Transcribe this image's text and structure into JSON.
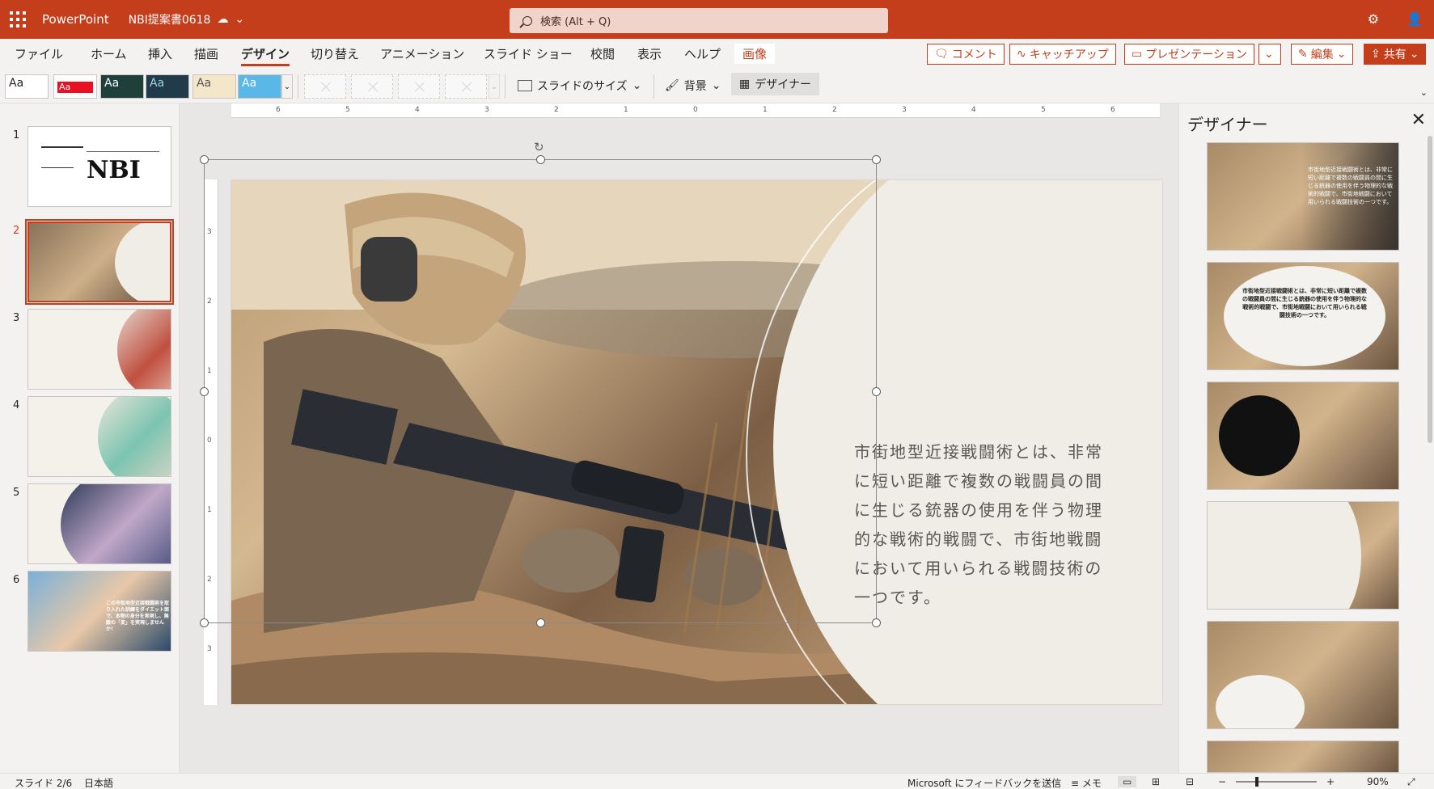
{
  "titlebar": {
    "app_name": "PowerPoint",
    "doc_name": "NBI提案書0618",
    "search_placeholder": "検索 (Alt + Q)"
  },
  "menu": {
    "tabs": [
      "ファイル",
      "ホーム",
      "挿入",
      "描画",
      "デザイン",
      "切り替え",
      "アニメーション",
      "スライド ショー",
      "校閲",
      "表示",
      "ヘルプ",
      "画像"
    ],
    "active_tab": "デザイン",
    "comment_label": "コメント",
    "catchup_label": "キャッチアップ",
    "present_label": "プレゼンテーション",
    "edit_label": "編集",
    "share_label": "共有"
  },
  "ribbon": {
    "theme_label": "Aa",
    "slide_size_label": "スライドのサイズ",
    "background_label": "背景",
    "designer_label": "デザイナー"
  },
  "slides": {
    "numbers": [
      "1",
      "2",
      "3",
      "4",
      "5",
      "6"
    ],
    "active": "2",
    "thumb1_title": "NBI",
    "thumb6_text": "この市街地型近接戦闘術を取り入れた訓練をダイエット面で、本物の身分を実現し、無敵の「変」を実現しませんか！"
  },
  "slide": {
    "body_text": "市街地型近接戦闘術とは、非常に短い距離で複数の戦闘員の間に生じる銃器の使用を伴う物理的な戦術的戦闘で、市街地戦闘において用いられる戦闘技術の一つです。"
  },
  "ruler": {
    "h_ticks": [
      "6",
      "5",
      "4",
      "3",
      "2",
      "1",
      "0",
      "1",
      "2",
      "3",
      "4",
      "5",
      "6"
    ],
    "v_ticks": [
      "3",
      "2",
      "1",
      "0",
      "1",
      "2",
      "3"
    ]
  },
  "designer": {
    "title": "デザイナー",
    "design_text_1": "市街地型近接戦闘術とは、非常に短い距離で複数の戦闘員の間に生じる銃器の使用を伴う物理的な戦術的戦闘で、市街地戦闘において用いられる戦闘技術の一つです。",
    "design_text_2": "市街地型近接戦闘術とは、非常に短い距離で複数の戦闘員の間に生じる銃器の使用を伴う物理的な戦術的戦闘で、市街地戦闘において用いられる戦闘技術の一つです。"
  },
  "status": {
    "slide_indicator": "スライド 2/6",
    "language": "日本語",
    "feedback": "Microsoft にフィードバックを送信",
    "notes": "メモ",
    "zoom": "90%"
  },
  "colors": {
    "accent": "#c43e1c",
    "background": "#f3f2f1"
  }
}
